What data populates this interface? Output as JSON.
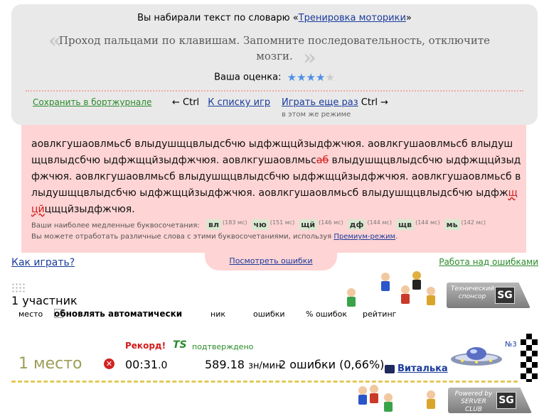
{
  "result": {
    "vocab_prefix": "Вы набирали текст по словарю «",
    "vocab_name": "Тренировка моторики",
    "vocab_suffix": "»",
    "quote": "Проход пальцами по клавишам. Запомните последовательность, отключите мозги.",
    "rating_label": "Ваша оценка:",
    "rating_stars": 4,
    "rating_max": 5,
    "save_link": "Сохранить в бортжурнале",
    "nav_prev_key": "← Ctrl",
    "back_to_list": "К списку игр",
    "play_again": "Играть еще раз",
    "play_again_key": "Ctrl →",
    "play_again_sub": "в этом же режиме"
  },
  "text_panel": {
    "text_before_err1": "аовлкгушаовлмьсб влыдушщцвлыдсбчю ыдфжщцйзыдфжчюя. аовлкгушаовлмьсб влыдушщцвлыдсбчю ыдфжщцйзыдфжчюя. аовлкгушаовлмьс",
    "err1": "аб",
    "text_between": " влыдушщцвлыдсбчю ыдфжщцйзыдфжчюя. аовлкгушаовлмьсб влыдушщцвлыдсбчю ыдфжщцйзыдфжчюя. аовлкгушаовлмьсб влыдушщцвлыдсбчю ыдфжщцйзыдфжчюя. аовлкгушаовлмьсб влыдушщцвлыдсбчю ыдфж",
    "err2": "щцй",
    "text_after_err2": "цщцйзыдфжчюя.",
    "slow_label": "Ваши наиболее медленные буквосочетания:",
    "slow_combos": [
      {
        "combo": "вл",
        "ms": "(183 мс)"
      },
      {
        "combo": "чю",
        "ms": "(151 мс)"
      },
      {
        "combo": "щй",
        "ms": "(146 мс)"
      },
      {
        "combo": "дф",
        "ms": "(144 мс)"
      },
      {
        "combo": "щв",
        "ms": "(144 мс)"
      },
      {
        "combo": "мь",
        "ms": "(142 мс)"
      }
    ],
    "premium_prefix": "Вы можете отработать различные слова с этими буквосочетаниями, используя ",
    "premium_link": "Премиум-режим",
    "premium_suffix": ".",
    "view_errors": "Посмотреть ошибки"
  },
  "lower": {
    "how_to_play": "Как играть?",
    "error_work": "Работа над ошибками",
    "participants": "1 участник",
    "col_place": "место",
    "col_auto_update": "обновлять автоматически",
    "col_nick": "ник",
    "col_errors": "ошибки",
    "col_error_pct": "% ошибок",
    "col_rating": "рейтинг",
    "tech_sponsor": "Технический спонсор",
    "powered_by": "Powered by SERVER CLUB"
  },
  "race": {
    "place": "1 место",
    "record": "Рекорд!",
    "ts_icon": "TS",
    "confirmed": "подтверждено",
    "time_main": "00:31",
    "time_ms": ".0",
    "speed": "589.18",
    "speed_unit": "зн/мин",
    "errors": "2 ошибки (0,66%)",
    "player_name": "Виталька",
    "car_number": "№3"
  },
  "colors": {
    "panel_gray": "#e9e9e9",
    "panel_pink": "#ffd4d4",
    "link_blue": "#1a3b9c",
    "green": "#2a8a2a",
    "error_red": "#d21a1a",
    "place_olive": "#9d9d58",
    "track_yellow": "#e3c95a"
  }
}
